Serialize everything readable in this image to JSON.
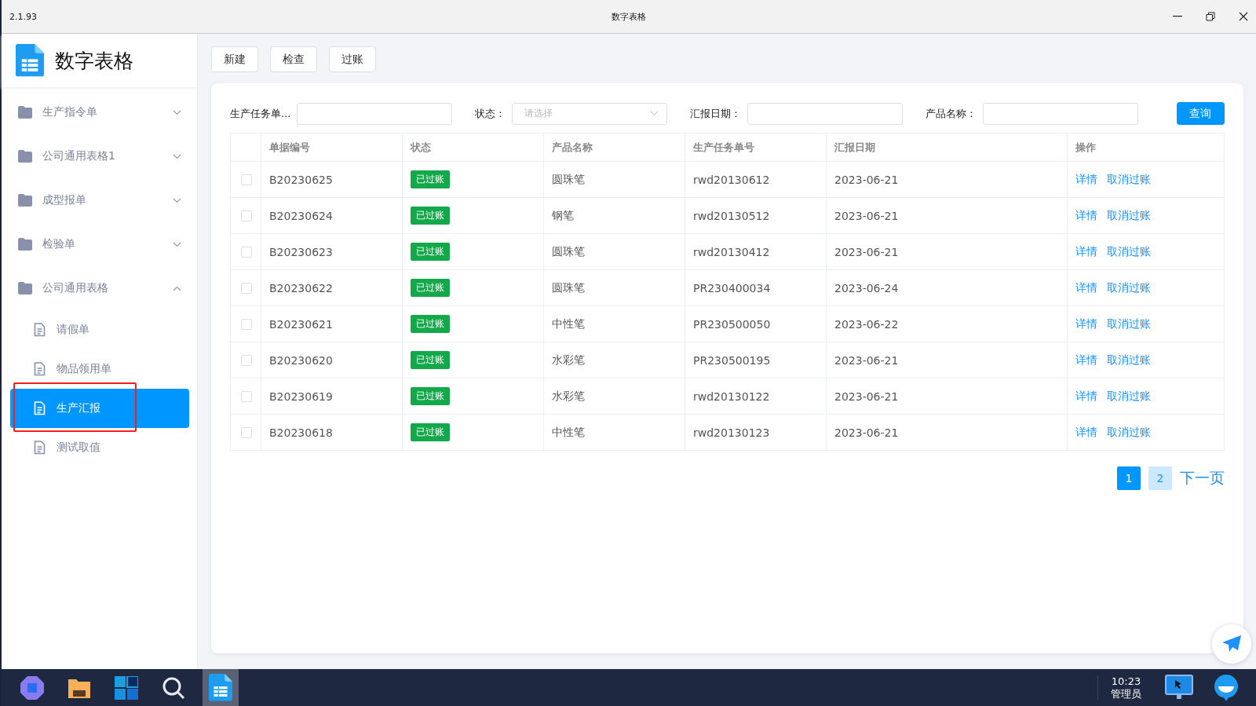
{
  "window": {
    "version": "2.1.93",
    "title": "数字表格"
  },
  "sidebar": {
    "app_name": "数字表格",
    "groups": [
      {
        "label": "生产指令单",
        "expanded": false
      },
      {
        "label": "公司通用表格1",
        "expanded": false
      },
      {
        "label": "成型报单",
        "expanded": false
      },
      {
        "label": "检验单",
        "expanded": false
      },
      {
        "label": "公司通用表格",
        "expanded": true,
        "children": [
          {
            "label": "请假单",
            "selected": false,
            "annotated": false
          },
          {
            "label": "物品领用单",
            "selected": false,
            "annotated": false
          },
          {
            "label": "生产汇报",
            "selected": true,
            "annotated": true
          },
          {
            "label": "测试取值",
            "selected": false,
            "annotated": false
          }
        ]
      }
    ]
  },
  "toolbar": {
    "buttons": [
      "新建",
      "检查",
      "过账"
    ]
  },
  "filters": [
    {
      "kind": "text",
      "label": "生产任务单..."
    },
    {
      "kind": "select",
      "label": "状态：",
      "placeholder": "请选择"
    },
    {
      "kind": "text",
      "label": "汇报日期："
    },
    {
      "kind": "text",
      "label": "产品名称："
    }
  ],
  "search_button": "查询",
  "table": {
    "columns": [
      "单据编号",
      "状态",
      "产品名称",
      "生产任务单号",
      "汇报日期",
      "操作"
    ],
    "rows": [
      {
        "checked": false,
        "code": "B20230625",
        "status": "已过账",
        "product": "圆珠笔",
        "task_no": "rwd20130612",
        "date": "2023-06-21",
        "actions": [
          "详情",
          "取消过账"
        ]
      },
      {
        "checked": false,
        "code": "B20230624",
        "status": "已过账",
        "product": "钢笔",
        "task_no": "rwd20130512",
        "date": "2023-06-21",
        "actions": [
          "详情",
          "取消过账"
        ]
      },
      {
        "checked": false,
        "code": "B20230623",
        "status": "已过账",
        "product": "圆珠笔",
        "task_no": "rwd20130412",
        "date": "2023-06-21",
        "actions": [
          "详情",
          "取消过账"
        ]
      },
      {
        "checked": false,
        "code": "B20230622",
        "status": "已过账",
        "product": "圆珠笔",
        "task_no": "PR230400034",
        "date": "2023-06-24",
        "actions": [
          "详情",
          "取消过账"
        ]
      },
      {
        "checked": false,
        "code": "B20230621",
        "status": "已过账",
        "product": "中性笔",
        "task_no": "PR230500050",
        "date": "2023-06-22",
        "actions": [
          "详情",
          "取消过账"
        ]
      },
      {
        "checked": false,
        "code": "B20230620",
        "status": "已过账",
        "product": "水彩笔",
        "task_no": "PR230500195",
        "date": "2023-06-21",
        "actions": [
          "详情",
          "取消过账"
        ]
      },
      {
        "checked": false,
        "code": "B20230619",
        "status": "已过账",
        "product": "水彩笔",
        "task_no": "rwd20130122",
        "date": "2023-06-21",
        "actions": [
          "详情",
          "取消过账"
        ]
      },
      {
        "checked": false,
        "code": "B20230618",
        "status": "已过账",
        "product": "中性笔",
        "task_no": "rwd20130123",
        "date": "2023-06-21",
        "actions": [
          "详情",
          "取消过账"
        ]
      }
    ]
  },
  "pagination": {
    "pages": [
      {
        "label": "1",
        "selected": true
      },
      {
        "label": "2",
        "selected": false
      }
    ],
    "next": "下一页"
  },
  "taskbar": {
    "time": "10:23",
    "user": "管理员"
  }
}
